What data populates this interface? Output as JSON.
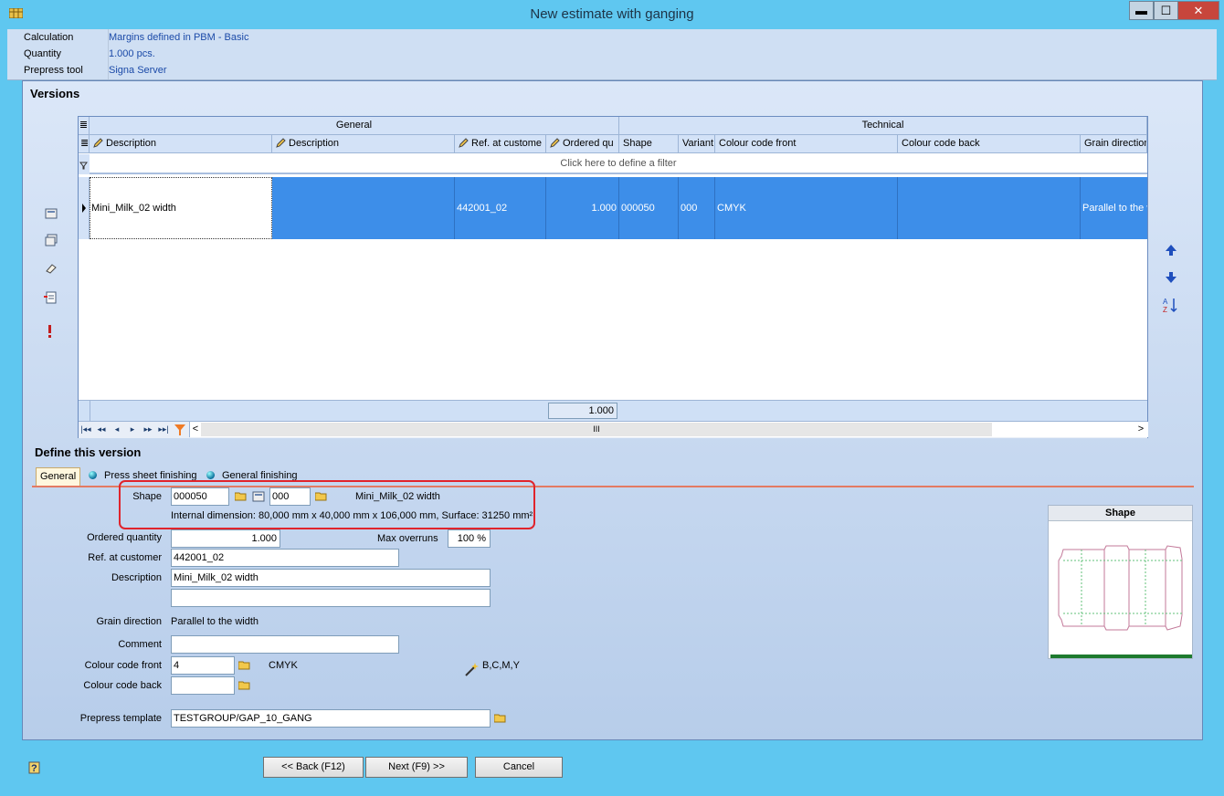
{
  "window": {
    "title": "New estimate with ganging",
    "minimize": "▬",
    "maximize": "☐",
    "close": "✕"
  },
  "info": {
    "rows": [
      {
        "label": "Calculation",
        "value": "Margins defined in PBM - Basic"
      },
      {
        "label": "Quantity",
        "value": "1.000 pcs."
      },
      {
        "label": "Prepress tool",
        "value": "Signa Server"
      }
    ]
  },
  "versions": {
    "title": "Versions",
    "bands": {
      "general": "General",
      "technical": "Technical"
    },
    "columns": [
      "Description",
      "Description",
      "Ref. at custome",
      "Ordered qu",
      "Shape",
      "Variant",
      "Colour code front",
      "Colour code back",
      "Grain direction"
    ],
    "filter_hint": "Click here to define a filter",
    "row": {
      "description1": "Mini_Milk_02 width",
      "description2": "",
      "ref": "442001_02",
      "ordered": "1.000",
      "shape": "000050",
      "variant": "000",
      "colour_front": "CMYK",
      "colour_back": "",
      "grain": "Parallel to the w"
    },
    "total": "1.000",
    "scroll_grip": "III"
  },
  "define": {
    "title": "Define this version",
    "tabs": [
      "General",
      "Press sheet finishing",
      "General finishing"
    ],
    "shape_label": "Shape",
    "shape_value": "000050",
    "variant_value": "000",
    "shape_name": "Mini_Milk_02 width",
    "internal_dimension": "Internal dimension: 80,000 mm x 40,000 mm x 106,000 mm, Surface: 31250 mm²",
    "ordered_label": "Ordered quantity",
    "ordered_value": "1.000",
    "max_overruns_label": "Max overruns",
    "max_overruns_value": "100 %",
    "ref_label": "Ref. at customer",
    "ref_value": "442001_02",
    "description_label": "Description",
    "description_value": "Mini_Milk_02 width",
    "description2_value": "",
    "grain_label": "Grain direction",
    "grain_value": "Parallel to the width",
    "comment_label": "Comment",
    "comment_value": "",
    "colour_front_label": "Colour code front",
    "colour_front_value": "4",
    "colour_front_name": "CMYK",
    "colour_back_label": "Colour code back",
    "colour_back_value": "",
    "inks": "B,C,M,Y",
    "prepress_label": "Prepress template",
    "prepress_value": "TESTGROUP/GAP_10_GANG",
    "shape_panel_title": "Shape"
  },
  "buttons": {
    "back": "<< Back (F12)",
    "next": "Next (F9) >>",
    "cancel": "Cancel"
  }
}
